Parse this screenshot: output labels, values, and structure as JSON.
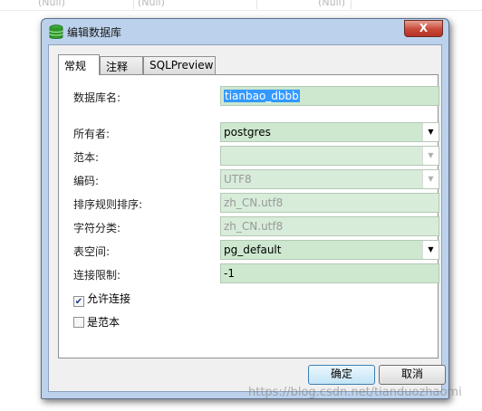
{
  "background": {
    "cells": [
      "(Null)",
      "(Null)",
      "(Null)"
    ]
  },
  "dialog": {
    "title": "编辑数据库",
    "close_label": "X",
    "tabs": [
      {
        "label": "常规"
      },
      {
        "label": "注释"
      },
      {
        "label": "SQLPreview"
      }
    ],
    "fields": {
      "db_name": {
        "label": "数据库名:",
        "value": "tianbao_dbbb"
      },
      "owner": {
        "label": "所有者:",
        "value": "postgres"
      },
      "template": {
        "label": "范本:",
        "value": ""
      },
      "encoding": {
        "label": "编码:",
        "value": "UTF8"
      },
      "collation": {
        "label": "排序规则排序:",
        "value": "zh_CN.utf8"
      },
      "ctype": {
        "label": "字符分类:",
        "value": "zh_CN.utf8"
      },
      "tablespace": {
        "label": "表空间:",
        "value": "pg_default"
      },
      "conn_limit": {
        "label": "连接限制:",
        "value": "-1"
      }
    },
    "checkboxes": {
      "allow_conn": {
        "label": "允许连接",
        "checked": true
      },
      "is_template": {
        "label": "是范本",
        "checked": false
      }
    },
    "buttons": {
      "ok": "确定",
      "cancel": "取消"
    }
  },
  "watermark": "https://blog.csdn.net/tianduozhaomi",
  "colors": {
    "field_bg": "#cde8cf",
    "selection": "#3399ff",
    "frame": "#bcd2ec"
  }
}
